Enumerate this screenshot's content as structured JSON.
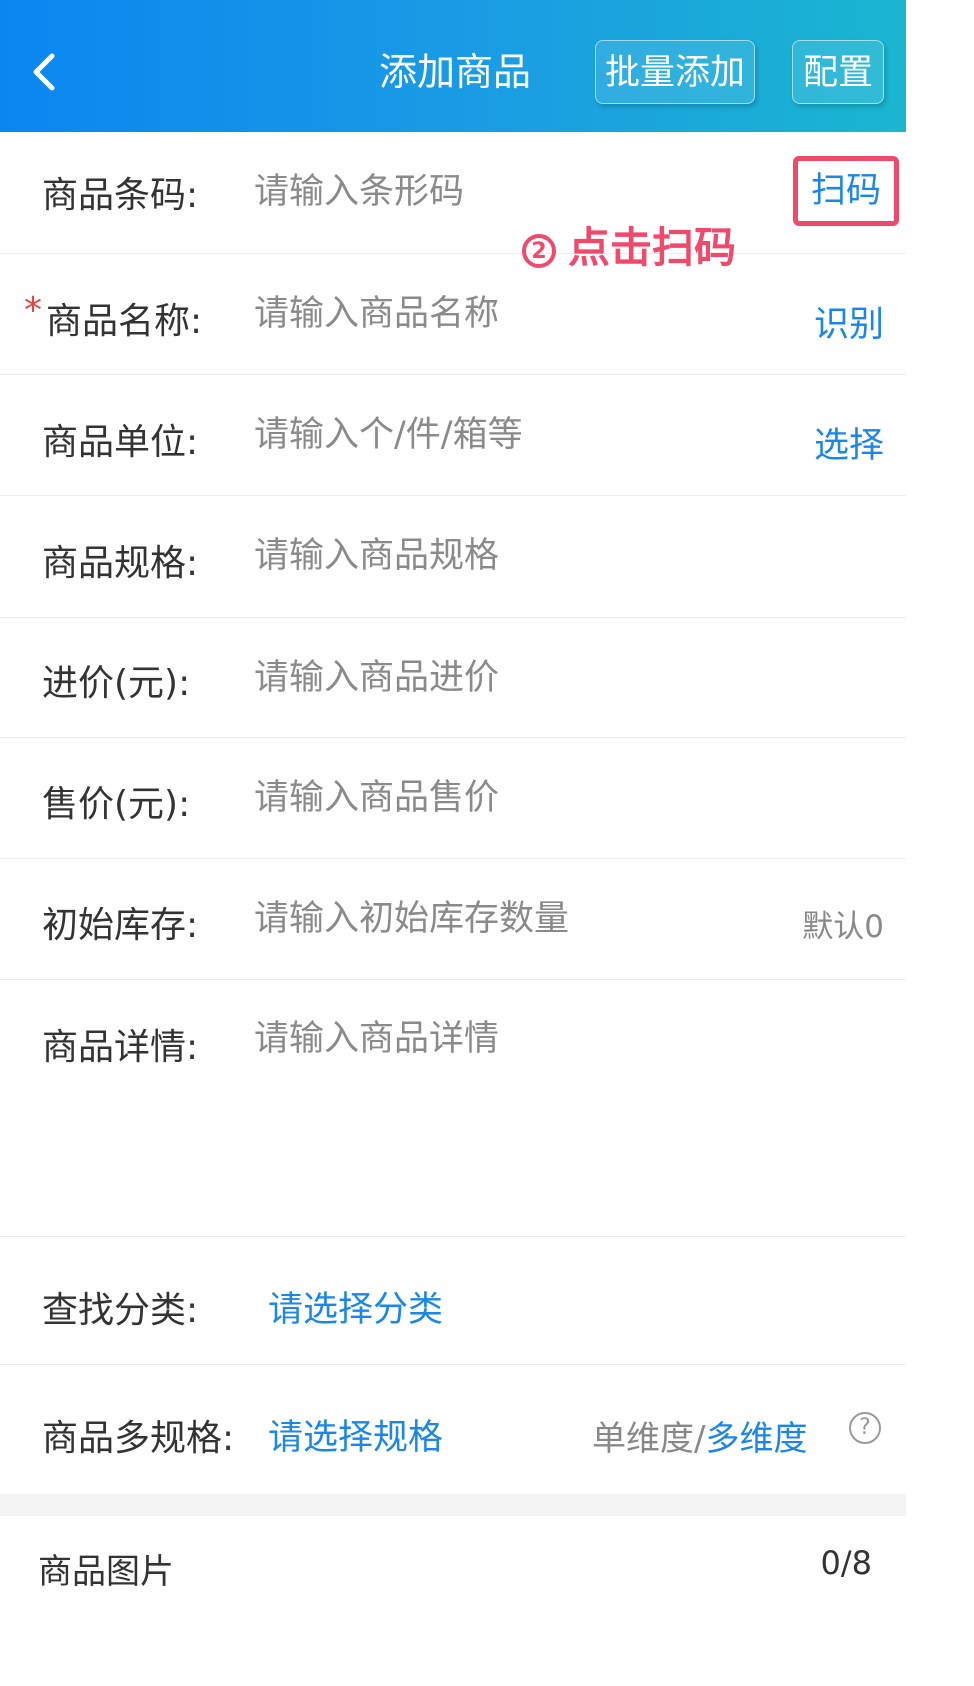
{
  "header": {
    "title": "添加商品",
    "batch_add": "批量添加",
    "config": "配置"
  },
  "annotation": {
    "number": "2",
    "text": "点击扫码"
  },
  "form": {
    "barcode": {
      "label": "商品条码:",
      "placeholder": "请输入条形码",
      "action": "扫码"
    },
    "name": {
      "required_mark": "*",
      "label": "商品名称:",
      "placeholder": "请输入商品名称",
      "action": "识别"
    },
    "unit": {
      "label": "商品单位:",
      "placeholder": "请输入个/件/箱等",
      "action": "选择"
    },
    "spec": {
      "label": "商品规格:",
      "placeholder": "请输入商品规格"
    },
    "purchase_price": {
      "label": "进价(元):",
      "placeholder": "请输入商品进价"
    },
    "sale_price": {
      "label": "售价(元):",
      "placeholder": "请输入商品售价"
    },
    "initial_stock": {
      "label": "初始库存:",
      "placeholder": "请输入初始库存数量",
      "hint": "默认0"
    },
    "detail": {
      "label": "商品详情:",
      "placeholder": "请输入商品详情"
    },
    "category": {
      "label": "查找分类:",
      "value": "请选择分类"
    },
    "multi_spec": {
      "label": "商品多规格:",
      "value": "请选择规格",
      "single_dim": "单维度/",
      "multi_dim": "多维度",
      "help": "?"
    },
    "images": {
      "label": "商品图片",
      "count": "0/8"
    }
  },
  "colors": {
    "header_start": "#0a86f0",
    "header_end": "#1ab6d0",
    "link_blue": "#1a86e8",
    "annotation_red": "#ef4a6c",
    "required_red": "#e94040"
  }
}
